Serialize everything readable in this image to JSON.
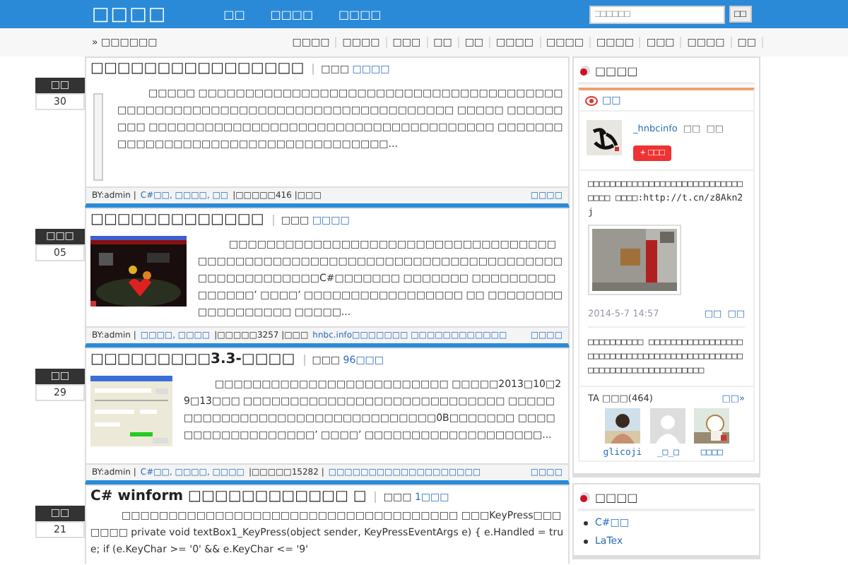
{
  "header": {
    "logo": "□□□□",
    "nav": [
      "□□",
      "□□□□",
      "□□□□"
    ],
    "search": {
      "placeholder": "□□□□□□"
    },
    "search_button": "□□"
  },
  "breadcrumb": "» □□□□□□",
  "top_links": [
    "□□□□",
    "□□□□",
    "□□□",
    "□□",
    "□□",
    "□□□□",
    "□□□□",
    "□□□□",
    "□□□",
    "□□□□",
    "□□"
  ],
  "posts": [
    {
      "month": "□□",
      "day": "30",
      "title": "□□□□□□□□□□□□□□□□",
      "meta_label": "□□□",
      "category": "□□□□",
      "media": {
        "kind": "frame"
      },
      "excerpt": "□□□□□ □□□□□□□□□□□□□□□□□□□□□□□□□□□□□□□□□□□□□□□□□□□□□□□□□□□□□□□□□□□□□□□□□□□□□□□□□□□ □□□□□ □□□□□□□□□ □□□□□□□□□□□□□□□□□□□□□□□□□□□□□□□□□□□□□ □□□□□□□□□□□□□□□□□□□□□□□□□□□□□□□□□□□□...",
      "footer": [
        {
          "kind": "text",
          "text": "BY:admin |"
        },
        {
          "kind": "link",
          "text": "C#□□, □□□□, □□"
        },
        {
          "kind": "text",
          "text": "|□□□□□416 |□□□"
        }
      ],
      "more": "□□□□"
    },
    {
      "month": "□□□",
      "day": "05",
      "title": "□□□□□□□□□□□□□",
      "meta_label": "□□□",
      "category": "□□□□",
      "excerpt": "□□□□□□□□□□□□□□□□□□□□□□□□□□□□□□□□□□□□□□□□□□□□□□□□□□□□□□□□□□□□□□□□□□□□□□□□□□□□□□□□□□□□□□□C#□□□□□□□ □□□□□□□ □□□□□□□□□□□□□□□’ □□□□’ □□□□□□□□□□□□□□□□□ □□ □□□□□□□□□□□□□□□□□□ □□□□□...",
      "footer": [
        {
          "kind": "text",
          "text": "BY:admin |"
        },
        {
          "kind": "link",
          "text": "□□□□, □□□□"
        },
        {
          "kind": "text",
          "text": "|□□□□□3257 |□□□"
        },
        {
          "kind": "link",
          "text": "hnbc.info□□□□□□□ □□□□□□□□□□□□"
        }
      ],
      "more": "□□□□"
    },
    {
      "month": "□□",
      "day": "29",
      "title": "□□□□□□□□□3.3-□□□□",
      "meta_label": "□□□",
      "category": "96□□□",
      "excerpt": "□□□□□□□□□□□□□□□□□□□□□□□□□ □□□□□2013□10□29□13□□□ □□□□□□□□□□□□□□□□□□□□□□□□□□□□ □□□□□□□□□□□□□□□□□□□□□□□□□□□□□□□□0B□□□□□□□ □□□□□□□□□□□□□□□□□□’ □□□□’ □□□□□□□□□□□□□□□□□□□...",
      "footer": [
        {
          "kind": "text",
          "text": "BY:admin |"
        },
        {
          "kind": "link",
          "text": "C#□□, □□□□, □□□□"
        },
        {
          "kind": "text",
          "text": "|□□□□□15282 |"
        },
        {
          "kind": "link",
          "text": "□□□□□□□□□□□□□□□□□□□"
        }
      ],
      "more": "□□□□"
    },
    {
      "month": "□□",
      "day": "21",
      "title": "C# winform □□□□□□□□□□□□ □",
      "meta_label": "□□□",
      "category": "1□□□",
      "media": {
        "kind": "none"
      },
      "excerpt": "□□□□□□□□□□□□□□□□□□□□□□□□□□□□□□□□□□□□ □□□KeyPress□□□□□□□ private void textBox1_KeyPress(object sender, KeyPressEventArgs e) { e.Handled = true; if (e.KeyChar >= '0' && e.KeyChar <= '9'"
    }
  ],
  "sidebar": {
    "weibo_widget": {
      "title": "□□□□",
      "tab": "□□",
      "user": "_hnbcinfo",
      "user_links": [
        "□□",
        "□□"
      ],
      "follow": "+ □□□",
      "posts": [
        {
          "text": "□□□□□□□□□□□□□□□□□□□□□□□□□□□□□□□□ □□□□:http://t.cn/z8Akn2j",
          "time": "2014-5-7 14:57",
          "actions": [
            "□□",
            "□□"
          ]
        },
        {
          "text": "□□□□□□□□□□ □□□□□□□□□□□□□□□□□□□□□□□□□□□□□□□□□□□□□□□□□□□□□□□□□□□□□□□□□□□□□□□□□□"
        }
      ],
      "fans_label": "TA □□□(464)",
      "fans_more": "□□»",
      "fans": [
        "glicoji",
        "_□_□",
        "□□□□"
      ]
    },
    "category_widget": {
      "title": "□□□□",
      "items": [
        "C#□□",
        "LaTex"
      ]
    }
  }
}
